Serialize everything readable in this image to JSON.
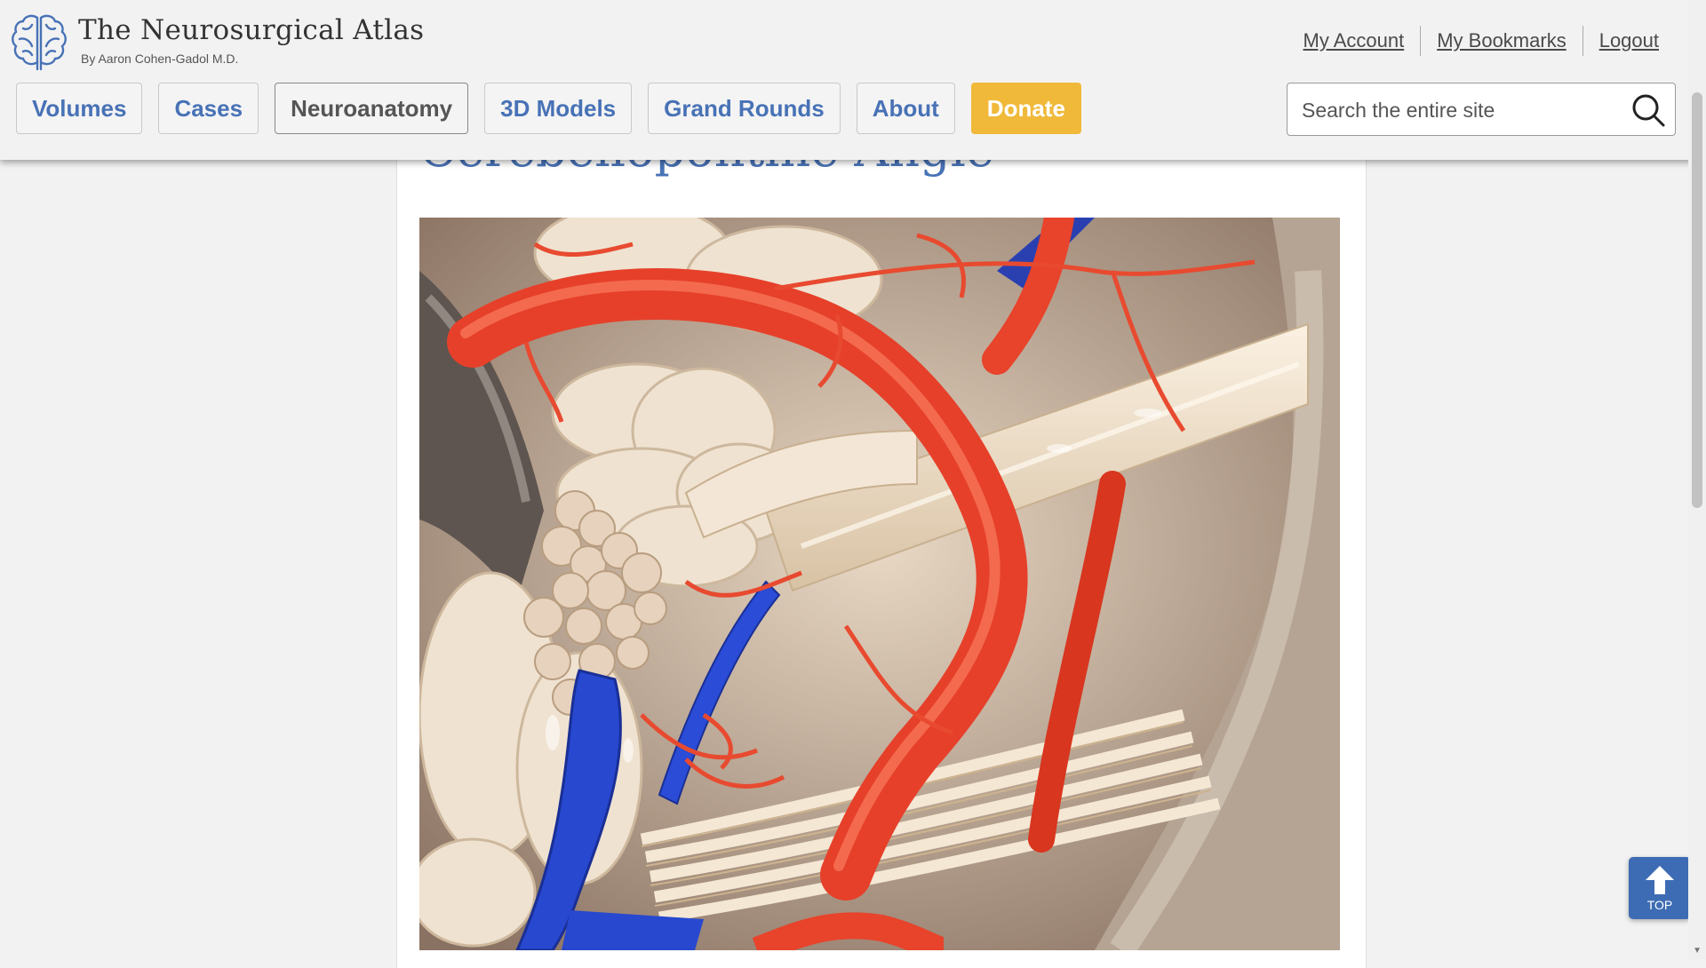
{
  "site": {
    "title": "The Neurosurgical Atlas",
    "subtitle": "By Aaron Cohen-Gadol M.D."
  },
  "account_links": [
    "My Account",
    "My Bookmarks",
    "Logout"
  ],
  "nav": {
    "items": [
      {
        "label": "Volumes",
        "state": "default"
      },
      {
        "label": "Cases",
        "state": "default"
      },
      {
        "label": "Neuroanatomy",
        "state": "active"
      },
      {
        "label": "3D Models",
        "state": "default"
      },
      {
        "label": "Grand Rounds",
        "state": "default"
      },
      {
        "label": "About",
        "state": "default"
      },
      {
        "label": "Donate",
        "state": "donate"
      }
    ]
  },
  "search": {
    "placeholder": "Search the entire site",
    "value": ""
  },
  "main": {
    "title": "Cerebellopontine Angle",
    "image_alt": "Cerebellopontine angle anatomy photograph"
  },
  "top_button": {
    "label": "TOP"
  },
  "colors": {
    "accent": "#4872b6",
    "donate": "#f0b93a",
    "top_button": "#3e6cb4",
    "background": "#f2f2f2"
  },
  "icons": [
    "brain-logo-icon",
    "search-icon",
    "arrow-up-icon"
  ]
}
